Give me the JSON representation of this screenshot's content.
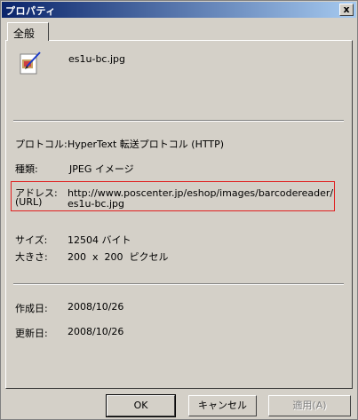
{
  "window": {
    "title": "プロパティ",
    "close_label": "x"
  },
  "tabs": [
    {
      "label": "全般"
    }
  ],
  "file": {
    "name": "es1u-bc.jpg",
    "icon": "jpeg-file-icon"
  },
  "properties": {
    "protocol": {
      "label": "プロトコル:",
      "value": "HyperText 転送プロトコル (HTTP)"
    },
    "type": {
      "label": "種類:",
      "value": "JPEG イメージ"
    },
    "address": {
      "label1": "アドレス:",
      "label2": "(URL)",
      "value1": "http://www.poscenter.jp/eshop/images/barcodereader/",
      "value2": "es1u-bc.jpg"
    },
    "size": {
      "label": "サイズ:",
      "value": "12504 バイト"
    },
    "dimensions": {
      "label": "大きさ:",
      "value": "200  x  200  ピクセル"
    },
    "created": {
      "label": "作成日:",
      "value": "2008/10/26"
    },
    "updated": {
      "label": "更新日:",
      "value": "2008/10/26"
    }
  },
  "buttons": {
    "ok": "OK",
    "cancel": "キャンセル",
    "apply": "適用(A)"
  },
  "colors": {
    "titlebar": "#0a246a",
    "highlight": "#e02020",
    "face": "#d4d0c8"
  }
}
